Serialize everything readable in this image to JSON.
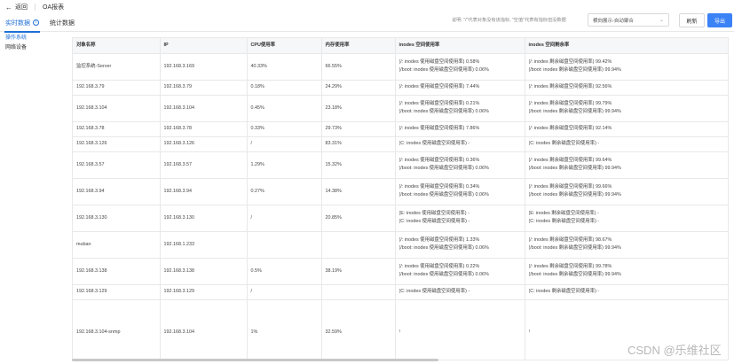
{
  "header": {
    "back_label": "返回",
    "title": "OA报表"
  },
  "tabs": [
    {
      "label": "实时数据",
      "active": true
    },
    {
      "label": "统计数据",
      "active": false
    }
  ],
  "toolbar": {
    "description": "说明: \"/\"代表对象没有该指标, \"空值\"代表有指标但没数据",
    "select_value": "横向展示-自动聚合",
    "refresh_label": "刷新",
    "export_label": "导出"
  },
  "sidebar": {
    "items": [
      {
        "label": "操作系统",
        "active": true
      },
      {
        "label": "网络设备",
        "active": false
      }
    ]
  },
  "table": {
    "columns": [
      "对象名称",
      "IP",
      "CPU使用率",
      "内存使用率",
      "inodes 空间使用率",
      "inodes 空间剩余率"
    ],
    "rows": [
      {
        "name": "监控系统-Server",
        "ip": "192.168.3.169",
        "cpu": "40.33%",
        "mem": "66.55%",
        "used": [
          "(/: inodes 使用磁盘空间使用率) 0.58%",
          "(/boot: inodes 使用磁盘空间使用率) 0.06%"
        ],
        "remain": [
          "(/: inodes 剩余磁盘空间使用率) 99.42%",
          "(/boot: inodes 剩余磁盘空间使用率) 99.94%"
        ]
      },
      {
        "name": "192.168.3.79",
        "ip": "192.168.3.79",
        "cpu": "0.18%",
        "mem": "24.29%",
        "used": [
          "(/: inodes 使用磁盘空间使用率) 7.44%"
        ],
        "remain": [
          "(/: inodes 剩余磁盘空间使用率) 92.56%"
        ]
      },
      {
        "name": "192.168.3.104",
        "ip": "192.168.3.104",
        "cpu": "0.45%",
        "mem": "23.18%",
        "used": [
          "(/: inodes 使用磁盘空间使用率) 0.21%",
          "(/boot: inodes 使用磁盘空间使用率) 0.06%"
        ],
        "remain": [
          "(/: inodes 剩余磁盘空间使用率) 99.79%",
          "(/boot: inodes 剩余磁盘空间使用率) 99.94%"
        ]
      },
      {
        "name": "192.168.3.78",
        "ip": "192.168.3.78",
        "cpu": "0.33%",
        "mem": "29.73%",
        "used": [
          "(/: inodes 使用磁盘空间使用率) 7.86%"
        ],
        "remain": [
          "(/: inodes 剩余磁盘空间使用率) 92.14%"
        ]
      },
      {
        "name": "192.168.3.126",
        "ip": "192.168.3.126",
        "cpu": "/",
        "mem": "83.31%",
        "used": [
          "(C: inodes 使用磁盘空间使用率) -"
        ],
        "remain": [
          "(C: inodes 剩余磁盘空间使用率) -"
        ]
      },
      {
        "name": "192.168.3.57",
        "ip": "192.168.3.57",
        "cpu": "1.29%",
        "mem": "15.32%",
        "used": [
          "(/: inodes 使用磁盘空间使用率) 0.36%",
          "(/boot: inodes 使用磁盘空间使用率) 0.06%"
        ],
        "remain": [
          "(/: inodes 剩余磁盘空间使用率) 99.64%",
          "(/boot: inodes 剩余磁盘空间使用率) 99.94%"
        ]
      },
      {
        "name": "192.168.3.94",
        "ip": "192.168.3.94",
        "cpu": "0.27%",
        "mem": "14.38%",
        "used": [
          "(/: inodes 使用磁盘空间使用率) 0.34%",
          "(/boot: inodes 使用磁盘空间使用率) 0.06%"
        ],
        "remain": [
          "(/: inodes 剩余磁盘空间使用率) 99.66%",
          "(/boot: inodes 剩余磁盘空间使用率) 99.94%"
        ]
      },
      {
        "name": "192.168.3.130",
        "ip": "192.168.3.130",
        "cpu": "/",
        "mem": "20.85%",
        "used": [
          "(E: inodes 使用磁盘空间使用率) -",
          "(C: inodes 使用磁盘空间使用率) -"
        ],
        "remain": [
          "(E: inodes 剩余磁盘空间使用率) -",
          "(C: inodes 剩余磁盘空间使用率) -"
        ]
      },
      {
        "name": "muban",
        "ip": "192.168.1.233",
        "cpu": "",
        "mem": "",
        "used": [
          "(/: inodes 使用磁盘空间使用率) 1.33%",
          "(/boot: inodes 使用磁盘空间使用率) 0.06%"
        ],
        "remain": [
          "(/: inodes 剩余磁盘空间使用率) 98.67%",
          "(/boot: inodes 剩余磁盘空间使用率) 99.94%"
        ]
      },
      {
        "name": "192.168.3.138",
        "ip": "192.168.3.138",
        "cpu": "0.5%",
        "mem": "38.19%",
        "used": [
          "(/: inodes 使用磁盘空间使用率) 0.22%",
          "(/boot: inodes 使用磁盘空间使用率) 0.06%"
        ],
        "remain": [
          "(/: inodes 剩余磁盘空间使用率) 99.78%",
          "(/boot: inodes 剩余磁盘空间使用率) 99.94%"
        ]
      },
      {
        "name": "192.168.3.129",
        "ip": "192.168.3.129",
        "cpu": "/",
        "mem": "",
        "used": [
          "(C: inodes 使用磁盘空间使用率) -"
        ],
        "remain": [
          "(C: inodes 剩余磁盘空间使用率) -"
        ]
      },
      {
        "name": "192.168.3.104-snmp",
        "ip": "192.168.3.104",
        "cpu": "1%",
        "mem": "32.59%",
        "used": [
          "/"
        ],
        "remain": [
          "/"
        ]
      }
    ]
  },
  "watermark": "CSDN @乐维社区"
}
